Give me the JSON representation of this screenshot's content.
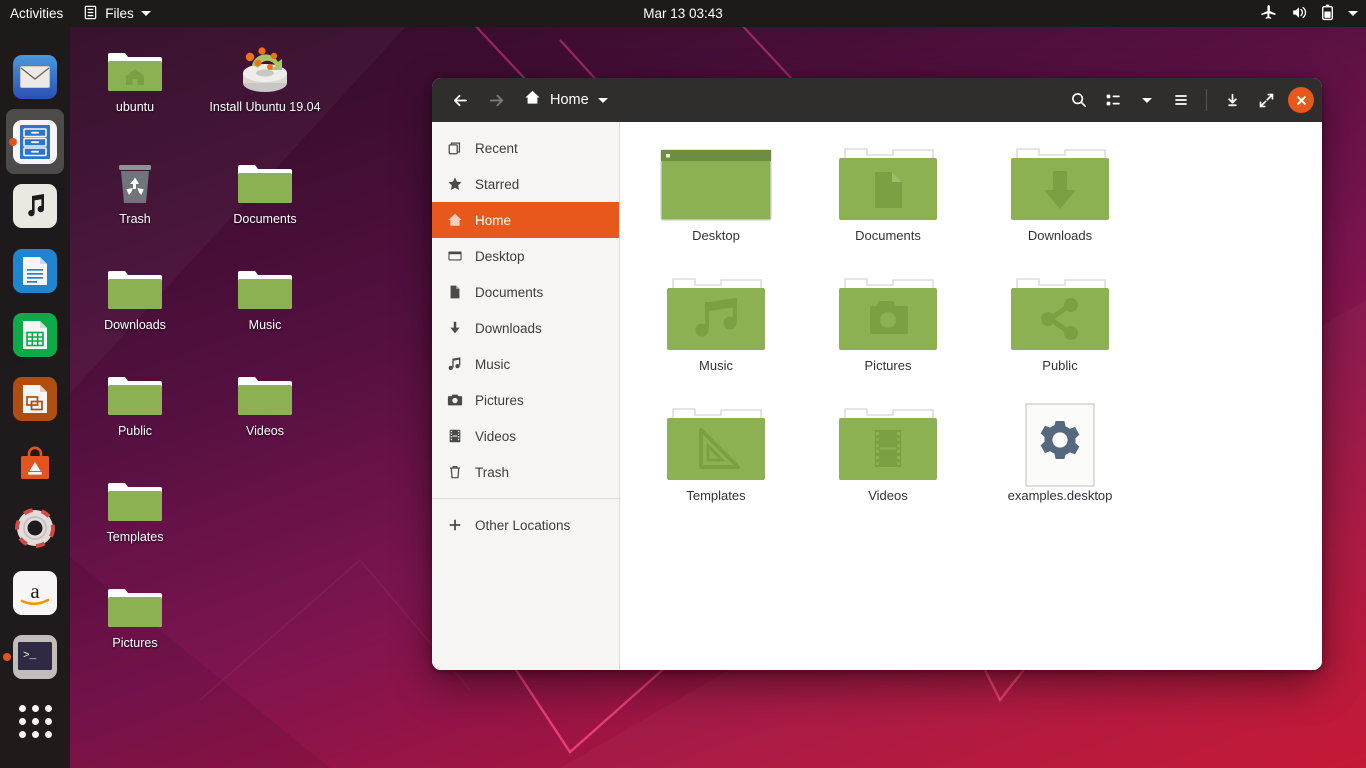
{
  "topbar": {
    "activities": "Activities",
    "app_name": "Files",
    "app_icon": "file-manager-icon",
    "clock": "Mar 13  03:43",
    "tray_icons": [
      "airplane-mode-icon",
      "volume-icon",
      "battery-icon",
      "system-menu-chevron-icon"
    ]
  },
  "dock": {
    "items": [
      {
        "name": "thunderbird",
        "icon": "mail-icon",
        "running": false,
        "focused": false
      },
      {
        "name": "files",
        "icon": "file-manager-icon",
        "running": true,
        "focused": true
      },
      {
        "name": "rhythmbox",
        "icon": "music-note-icon",
        "running": false,
        "focused": false
      },
      {
        "name": "libreoffice-writer",
        "icon": "document-icon",
        "running": false,
        "focused": false
      },
      {
        "name": "libreoffice-calc",
        "icon": "spreadsheet-icon",
        "running": false,
        "focused": false
      },
      {
        "name": "libreoffice-impress",
        "icon": "presentation-icon",
        "running": false,
        "focused": false
      },
      {
        "name": "ubuntu-software",
        "icon": "software-bag-icon",
        "running": false,
        "focused": false
      },
      {
        "name": "help",
        "icon": "lifebuoy-icon",
        "running": false,
        "focused": false
      },
      {
        "name": "amazon",
        "icon": "amazon-icon",
        "running": false,
        "focused": false
      },
      {
        "name": "terminal",
        "icon": "terminal-icon",
        "running": true,
        "focused": false
      }
    ],
    "show_applications_label": "Show Applications"
  },
  "desktop_icons": [
    {
      "label": "ubuntu",
      "icon": "home-folder-icon",
      "col": 0,
      "row": 0
    },
    {
      "label": "Install Ubuntu 19.04",
      "icon": "ubuntu-installer-icon",
      "col": 1,
      "row": 0
    },
    {
      "label": "Trash",
      "icon": "trash-icon",
      "col": 0,
      "row": 1
    },
    {
      "label": "Documents",
      "icon": "folder-icon",
      "col": 1,
      "row": 1
    },
    {
      "label": "Downloads",
      "icon": "folder-icon",
      "col": 0,
      "row": 2
    },
    {
      "label": "Music",
      "icon": "folder-icon",
      "col": 1,
      "row": 2
    },
    {
      "label": "Public",
      "icon": "folder-icon",
      "col": 0,
      "row": 3
    },
    {
      "label": "Videos",
      "icon": "folder-icon",
      "col": 1,
      "row": 3
    },
    {
      "label": "Templates",
      "icon": "folder-icon",
      "col": 0,
      "row": 4
    },
    {
      "label": "Pictures",
      "icon": "folder-icon",
      "col": 0,
      "row": 5
    }
  ],
  "window": {
    "title": "Home",
    "path_icon": "home-icon",
    "back_label": "Back",
    "forward_label": "Forward",
    "toolbar": [
      {
        "name": "search",
        "icon": "search-icon"
      },
      {
        "name": "view-mode",
        "icon": "list-view-icon"
      },
      {
        "name": "view-options",
        "icon": "chevron-down-icon"
      },
      {
        "name": "menu",
        "icon": "hamburger-menu-icon"
      },
      {
        "name": "minimize",
        "icon": "minimize-icon"
      },
      {
        "name": "maximize",
        "icon": "maximize-icon"
      },
      {
        "name": "close",
        "icon": "close-icon"
      }
    ]
  },
  "sidebar": {
    "items": [
      {
        "label": "Recent",
        "icon": "recent-icon",
        "selected": false
      },
      {
        "label": "Starred",
        "icon": "star-icon",
        "selected": false
      },
      {
        "label": "Home",
        "icon": "home-icon",
        "selected": true
      },
      {
        "label": "Desktop",
        "icon": "desktop-icon",
        "selected": false
      },
      {
        "label": "Documents",
        "icon": "document-icon",
        "selected": false
      },
      {
        "label": "Downloads",
        "icon": "download-arrow-icon",
        "selected": false
      },
      {
        "label": "Music",
        "icon": "music-note-icon",
        "selected": false
      },
      {
        "label": "Pictures",
        "icon": "camera-icon",
        "selected": false
      },
      {
        "label": "Videos",
        "icon": "film-strip-icon",
        "selected": false
      },
      {
        "label": "Trash",
        "icon": "trash-icon",
        "selected": false
      }
    ],
    "other_locations": {
      "label": "Other Locations",
      "icon": "plus-icon"
    }
  },
  "files": [
    {
      "name": "Desktop",
      "icon": "desktop-folder-icon",
      "type": "folder"
    },
    {
      "name": "Documents",
      "icon": "documents-folder-icon",
      "type": "folder"
    },
    {
      "name": "Downloads",
      "icon": "downloads-folder-icon",
      "type": "folder"
    },
    {
      "name": "Music",
      "icon": "music-folder-icon",
      "type": "folder"
    },
    {
      "name": "Pictures",
      "icon": "pictures-folder-icon",
      "type": "folder"
    },
    {
      "name": "Public",
      "icon": "public-folder-icon",
      "type": "folder"
    },
    {
      "name": "Templates",
      "icon": "templates-folder-icon",
      "type": "folder"
    },
    {
      "name": "Videos",
      "icon": "videos-folder-icon",
      "type": "folder"
    },
    {
      "name": "examples.desktop",
      "icon": "gear-document-icon",
      "type": "file"
    }
  ],
  "colors": {
    "accent": "#e8571c",
    "folder_green": "#8cb152",
    "header_dark": "#302e2c",
    "topbar_dark": "#1d1b1a",
    "sidebar_bg": "#f6f5f4"
  }
}
